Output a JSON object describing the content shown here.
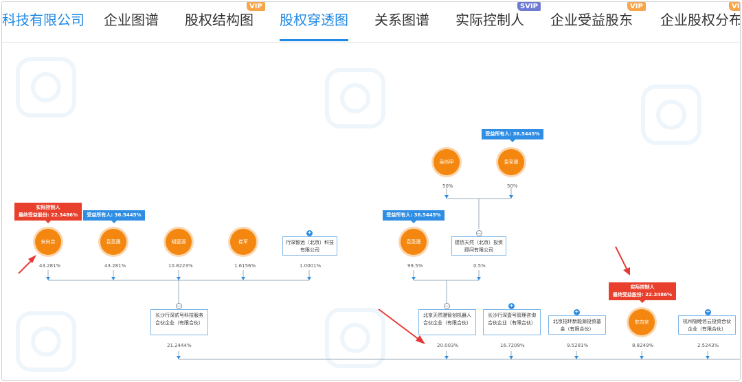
{
  "tabs": [
    {
      "label": "科技有限公司"
    },
    {
      "label": "企业图谱"
    },
    {
      "label": "股权结构图",
      "badge": "VIP"
    },
    {
      "label": "股权穿透图"
    },
    {
      "label": "关系图谱"
    },
    {
      "label": "实际控制人",
      "badge": "SVIP"
    },
    {
      "label": "企业受益股东",
      "badge": "VIP"
    },
    {
      "label": "企业股权分布",
      "badge": "VI"
    }
  ],
  "colors": {
    "accent": "#1e88e5",
    "node": "#f3870f",
    "red_tag": "#e8402c",
    "blue_tag": "#2f8ee3",
    "line": "#9aa9b8",
    "arrow_annotation": "#e53935"
  },
  "graph": {
    "top_shareholders": [
      {
        "name": "吴尚甲",
        "pct": "50%"
      },
      {
        "name": "袁圣晟",
        "pct": "50%",
        "tag": "受益所有人: 36.5445%"
      }
    ],
    "level1": [
      {
        "name": "安向京",
        "pct": "43.281%",
        "tag_title": "实际控制人",
        "tag_line": "最终受益股份: 22.3486%"
      },
      {
        "name": "袁圣晟",
        "pct": "43.281%",
        "tag": "受益所有人: 36.5445%"
      },
      {
        "name": "胡庭源",
        "pct": "10.8223%"
      },
      {
        "name": "崔军",
        "pct": "1.6156%"
      },
      {
        "name": "行深智远（北京）科技有限公司",
        "pct": "1.0001%"
      },
      {
        "name": "袁圣晟",
        "pct": "99.5%",
        "tag": "受益所有人: 36.5445%"
      },
      {
        "name": "建信天然（北京）投资顾问有限公司",
        "pct": "0.5%"
      }
    ],
    "level2": [
      {
        "name": "长沙行深贰号科技服务合伙企业（有限合伙）",
        "pct": "21.2444%"
      },
      {
        "name": "北京天然漫智创机器人合伙企业（有限合伙）",
        "pct": "20.003%"
      },
      {
        "name": "长沙行深壹号管理咨询合伙企业（有限合伙）",
        "pct": "16.7209%"
      },
      {
        "name": "北京招环新能源投资基金（有限合伙）",
        "pct": "9.5281%"
      },
      {
        "name": "安向京",
        "pct": "8.8249%",
        "tag_title": "实际控制人",
        "tag_line": "最终受益股份: 22.3486%"
      },
      {
        "name": "杭州隐睦信云投资合伙企业（有限合伙）",
        "pct": "2.5243%"
      }
    ]
  }
}
